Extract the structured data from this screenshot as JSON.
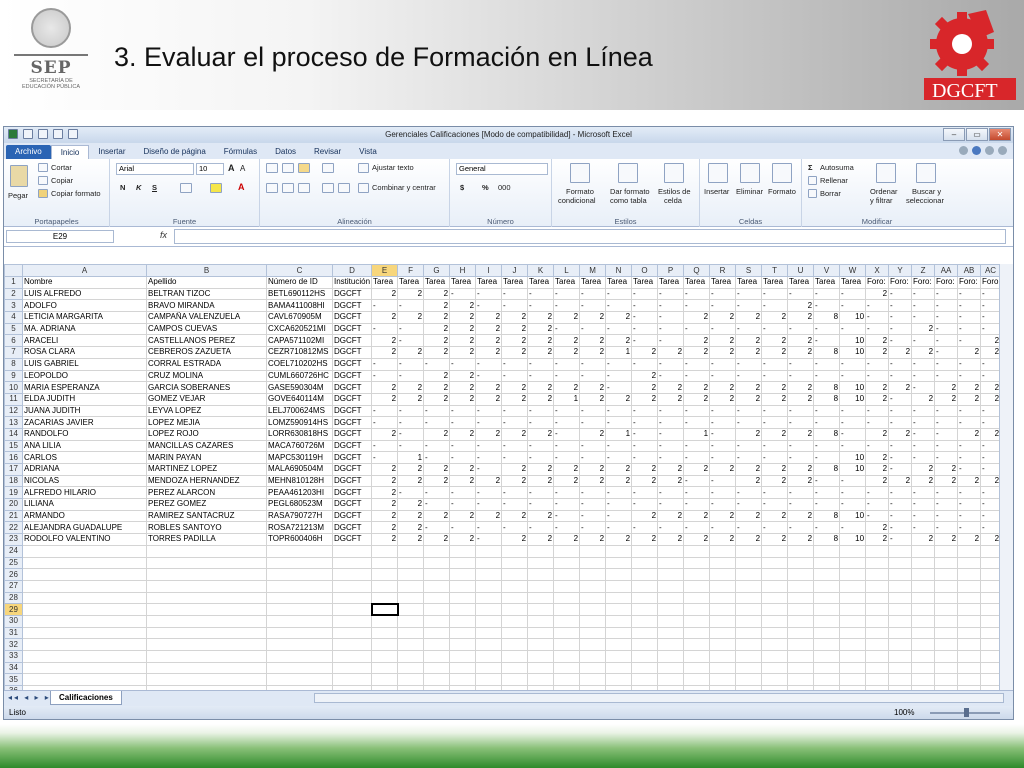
{
  "slide": {
    "title": "3. Evaluar el proceso de Formación en Línea",
    "sep_logo": {
      "word": "SEP",
      "sub1": "SECRETARÍA DE",
      "sub2": "EDUCACIÓN PÚBLICA"
    },
    "dgcft_logo": {
      "word": "DGCFT"
    },
    "colors": {
      "dgcft_red": "#d8262a",
      "band_green": "#2e8a2a"
    }
  },
  "excel": {
    "window_title": "Gerenciales Calificaciones [Modo de compatibilidad] - Microsoft Excel",
    "tabs": [
      "Archivo",
      "Inicio",
      "Insertar",
      "Diseño de página",
      "Fórmulas",
      "Datos",
      "Revisar",
      "Vista"
    ],
    "active_tab": "Inicio",
    "ribbon": {
      "paste": "Pegar",
      "cut": "Cortar",
      "copy": "Copiar",
      "format_painter": "Copiar formato",
      "clipboard": "Portapapeles",
      "font_name": "Arial",
      "font_size": "10",
      "bold": "N",
      "italic": "K",
      "underline": "S",
      "font_group": "Fuente",
      "wrap_text": "Ajustar texto",
      "merge_center": "Combinar y centrar",
      "alignment_group": "Alineación",
      "number_format": "General",
      "currency": "$",
      "percent": "%",
      "thousands": "000",
      "number_group": "Número",
      "cond_format_1": "Formato",
      "cond_format_2": "condicional",
      "format_table_1": "Dar formato",
      "format_table_2": "como tabla",
      "cell_styles_1": "Estilos de",
      "cell_styles_2": "celda",
      "styles_group": "Estilos",
      "insert": "Insertar",
      "delete": "Eliminar",
      "format": "Formato",
      "cells_group": "Celdas",
      "autosum": "Autosuma",
      "fill": "Rellenar",
      "clear": "Borrar",
      "sort_1": "Ordenar",
      "sort_2": "y filtrar",
      "find_1": "Buscar y",
      "find_2": "seleccionar",
      "modify_group": "Modificar"
    },
    "name_box": "E29",
    "fx": "fx",
    "columns": [
      "A",
      "B",
      "C",
      "D",
      "E",
      "F",
      "G",
      "H",
      "I",
      "J",
      "K",
      "L",
      "M",
      "N",
      "O",
      "P",
      "Q",
      "R",
      "S",
      "T",
      "U",
      "V",
      "W",
      "X",
      "Y",
      "Z",
      "AA",
      "AB",
      "AC"
    ],
    "selected_col": "E",
    "selected_row": 29,
    "rows": [
      [
        "Nombre",
        "Apellido",
        "Número de ID",
        "Institución",
        "Tarea",
        "Tarea",
        "Tarea",
        "Tarea",
        "Tarea",
        "Tarea",
        "Tarea",
        "Tarea",
        "Tarea",
        "Tarea",
        "Tarea",
        "Tarea",
        "Tarea",
        "Tarea",
        "Tarea",
        "Tarea",
        "Tarea",
        "Tarea",
        "Tarea",
        "Foro:",
        "Foro:",
        "Foro:",
        "Foro:",
        "Foro:",
        "Foro"
      ],
      [
        "LUIS ALFREDO",
        "BELTRAN TIZOC",
        "BETL690112HS",
        "DGCFT",
        "2",
        "2",
        "2",
        "-",
        "-",
        "-",
        "-",
        "-",
        "-",
        "-",
        "-",
        "-",
        "-",
        "-",
        "-",
        "-",
        "-",
        "-",
        "-",
        "2",
        "-",
        "-",
        "-",
        "-",
        "-"
      ],
      [
        "ADOLFO",
        "BRAVO MIRANDA",
        "BAMA411008HI",
        "DGCFT",
        "-",
        "-",
        "2",
        "2",
        "-",
        "-",
        "-",
        "-",
        "-",
        "-",
        "-",
        "-",
        "-",
        "-",
        "-",
        "-",
        "2",
        "-",
        "-",
        "-",
        "-",
        "-",
        "-",
        "-",
        "-"
      ],
      [
        "LETICIA MARGARITA",
        "CAMPAÑA VALENZUELA",
        "CAVL670905M",
        "DGCFT",
        "2",
        "2",
        "2",
        "2",
        "2",
        "2",
        "2",
        "2",
        "2",
        "2",
        "-",
        "-",
        "2",
        "2",
        "2",
        "2",
        "2",
        "8",
        "10",
        "-",
        "-",
        "-",
        "-",
        "-",
        "-"
      ],
      [
        "MA. ADRIANA",
        "CAMPOS CUEVAS",
        "CXCA620521MI",
        "DGCFT",
        "-",
        "-",
        "2",
        "2",
        "2",
        "2",
        "2",
        "-",
        "-",
        "-",
        "-",
        "-",
        "-",
        "-",
        "-",
        "-",
        "-",
        "-",
        "-",
        "-",
        "-",
        "2",
        "-",
        "-",
        "-"
      ],
      [
        "ARACELI",
        "CASTELLANOS PEREZ",
        "CAPA571102MI",
        "DGCFT",
        "2",
        "-",
        "2",
        "2",
        "2",
        "2",
        "2",
        "2",
        "2",
        "2",
        "-",
        "-",
        "2",
        "2",
        "2",
        "2",
        "2",
        "-",
        "10",
        "2",
        "-",
        "-",
        "-",
        "-",
        "2"
      ],
      [
        "ROSA CLARA",
        "CEBREROS ZAZUETA",
        "CEZR710812MS",
        "DGCFT",
        "2",
        "2",
        "2",
        "2",
        "2",
        "2",
        "2",
        "2",
        "2",
        "1",
        "2",
        "2",
        "2",
        "2",
        "2",
        "2",
        "2",
        "8",
        "10",
        "2",
        "2",
        "2",
        "-",
        "2",
        "2"
      ],
      [
        "LUIS GABRIEL",
        "CORRAL ESTRADA",
        "COEL710202HS",
        "DGCFT",
        "-",
        "-",
        "-",
        "-",
        "-",
        "-",
        "-",
        "-",
        "-",
        "-",
        "-",
        "-",
        "-",
        "-",
        "-",
        "-",
        "-",
        "-",
        "-",
        "-",
        "-",
        "-",
        "-",
        "-",
        "-"
      ],
      [
        "LEOPOLDO",
        "CRUZ MOLINA",
        "CUML660726HC",
        "DGCFT",
        "-",
        "-",
        "2",
        "2",
        "-",
        "-",
        "-",
        "-",
        "-",
        "-",
        "2",
        "-",
        "-",
        "-",
        "-",
        "-",
        "-",
        "-",
        "-",
        "-",
        "-",
        "-",
        "-",
        "-",
        "-"
      ],
      [
        "MARIA ESPERANZA",
        "GARCIA SOBERANES",
        "GASE590304M",
        "DGCFT",
        "2",
        "2",
        "2",
        "2",
        "2",
        "2",
        "2",
        "2",
        "2",
        "-",
        "2",
        "2",
        "2",
        "2",
        "2",
        "2",
        "2",
        "8",
        "10",
        "2",
        "2",
        "-",
        "2",
        "2",
        "2"
      ],
      [
        "ELDA JUDITH",
        "GOMEZ VEJAR",
        "GOVE640114M",
        "DGCFT",
        "2",
        "2",
        "2",
        "2",
        "2",
        "2",
        "2",
        "1",
        "2",
        "2",
        "2",
        "2",
        "2",
        "2",
        "2",
        "2",
        "2",
        "8",
        "10",
        "2",
        "-",
        "2",
        "2",
        "2",
        "2"
      ],
      [
        "JUANA JUDITH",
        "LEYVA LOPEZ",
        "LELJ700624MS",
        "DGCFT",
        "-",
        "-",
        "-",
        "-",
        "-",
        "-",
        "-",
        "-",
        "-",
        "-",
        "-",
        "-",
        "-",
        "-",
        "-",
        "-",
        "-",
        "-",
        "-",
        "-",
        "-",
        "-",
        "-",
        "-",
        "-"
      ],
      [
        "ZACARIAS JAVIER",
        "LOPEZ MEJIA",
        "LOMZ590914HS",
        "DGCFT",
        "-",
        "-",
        "-",
        "-",
        "-",
        "-",
        "-",
        "-",
        "-",
        "-",
        "-",
        "-",
        "-",
        "-",
        "-",
        "-",
        "-",
        "-",
        "-",
        "-",
        "-",
        "-",
        "-",
        "-",
        "-"
      ],
      [
        "RANDOLFO",
        "LOPEZ ROJO",
        "LORR630818HS",
        "DGCFT",
        "2",
        "-",
        "2",
        "2",
        "2",
        "2",
        "2",
        "-",
        "2",
        "1",
        "-",
        "-",
        "1",
        "-",
        "2",
        "2",
        "2",
        "8",
        "-",
        "2",
        "2",
        "-",
        "-",
        "2",
        "2"
      ],
      [
        "ANA LILIA",
        "MANCILLAS CAZARES",
        "MACA760726M",
        "DGCFT",
        "-",
        "-",
        "-",
        "-",
        "-",
        "-",
        "-",
        "-",
        "-",
        "-",
        "-",
        "-",
        "-",
        "-",
        "-",
        "-",
        "-",
        "-",
        "-",
        "-",
        "-",
        "-",
        "-",
        "-",
        "-"
      ],
      [
        "CARLOS",
        "MARIN PAYAN",
        "MAPC530119H",
        "DGCFT",
        "-",
        "1",
        "-",
        "-",
        "-",
        "-",
        "-",
        "-",
        "-",
        "-",
        "-",
        "-",
        "-",
        "-",
        "-",
        "-",
        "-",
        "-",
        "10",
        "2",
        "-",
        "-",
        "-",
        "-",
        "-"
      ],
      [
        "ADRIANA",
        "MARTINEZ LOPEZ",
        "MALA690504M",
        "DGCFT",
        "2",
        "2",
        "2",
        "2",
        "-",
        "2",
        "2",
        "2",
        "2",
        "2",
        "2",
        "2",
        "2",
        "2",
        "2",
        "2",
        "2",
        "8",
        "10",
        "2",
        "-",
        "2",
        "2",
        "-",
        "-"
      ],
      [
        "NICOLAS",
        "MENDOZA HERNANDEZ",
        "MEHN810128H",
        "DGCFT",
        "2",
        "2",
        "2",
        "2",
        "2",
        "2",
        "2",
        "2",
        "2",
        "2",
        "2",
        "2",
        "-",
        "-",
        "2",
        "2",
        "2",
        "-",
        "-",
        "2",
        "2",
        "2",
        "2",
        "2",
        "2"
      ],
      [
        "ALFREDO HILARIO",
        "PEREZ ALARCON",
        "PEAA461203HI",
        "DGCFT",
        "2",
        "-",
        "-",
        "-",
        "-",
        "-",
        "-",
        "-",
        "-",
        "-",
        "-",
        "-",
        "-",
        "-",
        "-",
        "-",
        "-",
        "-",
        "-",
        "-",
        "-",
        "-",
        "-",
        "-",
        "-"
      ],
      [
        "LILIANA",
        "PEREZ GOMEZ",
        "PEGL680523M",
        "DGCFT",
        "2",
        "2",
        "-",
        "-",
        "-",
        "-",
        "-",
        "-",
        "-",
        "-",
        "-",
        "-",
        "-",
        "-",
        "-",
        "-",
        "-",
        "-",
        "-",
        "-",
        "-",
        "-",
        "-",
        "-",
        "-"
      ],
      [
        "ARMANDO",
        "RAMIREZ SANTACRUZ",
        "RASA790727H",
        "DGCFT",
        "2",
        "2",
        "2",
        "2",
        "2",
        "2",
        "2",
        "-",
        "-",
        "-",
        "2",
        "2",
        "2",
        "2",
        "2",
        "2",
        "2",
        "8",
        "10",
        "-",
        "-",
        "-",
        "-",
        "-",
        "-"
      ],
      [
        "ALEJANDRA GUADALUPE",
        "ROBLES SANTOYO",
        "ROSA721213M",
        "DGCFT",
        "2",
        "2",
        "-",
        "-",
        "-",
        "-",
        "-",
        "-",
        "-",
        "-",
        "-",
        "-",
        "-",
        "-",
        "-",
        "-",
        "-",
        "-",
        "-",
        "2",
        "-",
        "-",
        "-",
        "-",
        "-"
      ],
      [
        "RODOLFO VALENTINO",
        "TORRES PADILLA",
        "TOPR600406H",
        "DGCFT",
        "2",
        "2",
        "2",
        "2",
        "-",
        "2",
        "2",
        "2",
        "2",
        "2",
        "2",
        "2",
        "2",
        "2",
        "2",
        "2",
        "2",
        "8",
        "10",
        "2",
        "-",
        "2",
        "2",
        "2",
        "2"
      ]
    ],
    "empty_rows_until": 37,
    "sheet_tab": "Calificaciones",
    "status": "Listo",
    "zoom": "100%"
  }
}
